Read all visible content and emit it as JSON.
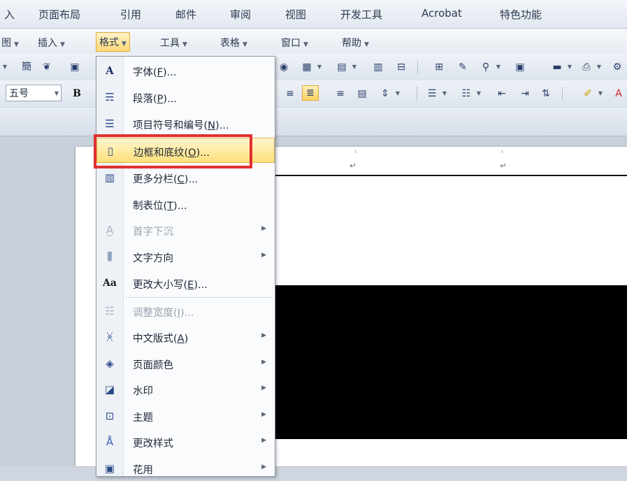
{
  "ribbon_tabs": [
    "入",
    "页面布局",
    "引用",
    "邮件",
    "审阅",
    "视图",
    "开发工具",
    "Acrobat",
    "特色功能"
  ],
  "menubar": {
    "items": [
      "图",
      "插入",
      "格式",
      "工具",
      "表格",
      "窗口",
      "帮助"
    ],
    "active": "格式"
  },
  "toolbar": {
    "font_size": "五号",
    "bold_label": "B"
  },
  "dropdown": {
    "items": [
      {
        "icon": "A",
        "label": "字体(",
        "key": "F",
        "suffix": ")...",
        "submenu": false,
        "disabled": false
      },
      {
        "icon": "paragraph-icon",
        "label": "段落(",
        "key": "P",
        "suffix": ")...",
        "submenu": false,
        "disabled": false
      },
      {
        "icon": "list-icon",
        "label": "项目符号和编号(",
        "key": "N",
        "suffix": ")...",
        "submenu": false,
        "disabled": false
      },
      {
        "icon": "page-icon",
        "label": "边框和底纹(",
        "key": "O",
        "suffix": ")...",
        "submenu": false,
        "disabled": false,
        "hover": true
      },
      {
        "icon": "columns-icon",
        "label": "更多分栏(",
        "key": "C",
        "suffix": ")...",
        "submenu": false,
        "disabled": false
      },
      {
        "icon": "",
        "label": "制表位(",
        "key": "T",
        "suffix": ")...",
        "submenu": false,
        "disabled": false
      },
      {
        "icon": "dropcap-icon",
        "label": "首字下沉",
        "key": "",
        "suffix": "",
        "submenu": true,
        "disabled": true
      },
      {
        "icon": "text-direction-icon",
        "label": "文字方向",
        "key": "",
        "suffix": "",
        "submenu": true,
        "disabled": false
      },
      {
        "icon": "Aa",
        "label": "更改大小写(",
        "key": "E",
        "suffix": ")...",
        "submenu": false,
        "disabled": false
      },
      {
        "icon": "width-icon",
        "label": "调整宽度(",
        "key": "I",
        "suffix": ")...",
        "submenu": false,
        "disabled": true
      },
      {
        "icon": "chinese-layout-icon",
        "label": "中文版式(",
        "key": "A",
        "suffix": ")",
        "submenu": true,
        "disabled": false
      },
      {
        "icon": "page-color-icon",
        "label": "页面颜色",
        "key": "",
        "suffix": "",
        "submenu": true,
        "disabled": false
      },
      {
        "icon": "watermark-icon",
        "label": "水印",
        "key": "",
        "suffix": "",
        "submenu": true,
        "disabled": false
      },
      {
        "icon": "theme-icon",
        "label": "主题",
        "key": "",
        "suffix": "",
        "submenu": true,
        "disabled": false
      },
      {
        "icon": "styles-icon",
        "label": "更改样式",
        "key": "",
        "suffix": "",
        "submenu": true,
        "disabled": false
      },
      {
        "icon": "apply-icon",
        "label": "花用",
        "key": "",
        "suffix": "",
        "submenu": true,
        "disabled": false
      }
    ]
  },
  "document": {
    "paragraph_mark": "↵"
  },
  "colors": {
    "highlight_box": "#e03030",
    "hover_fill": "#ffe07a"
  }
}
